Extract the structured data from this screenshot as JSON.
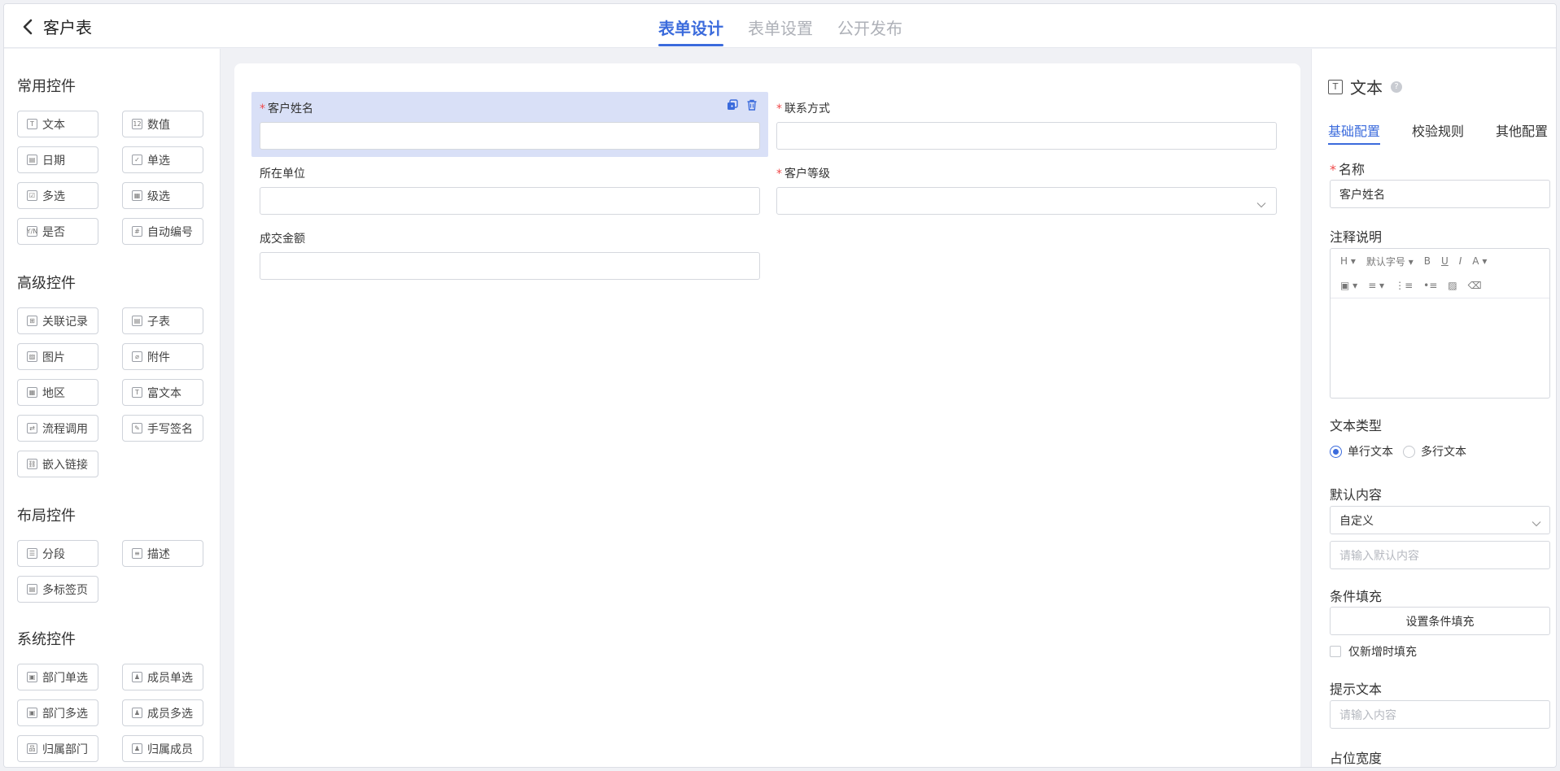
{
  "header": {
    "title": "客户表",
    "tabs": [
      {
        "label": "表单设计",
        "active": true
      },
      {
        "label": "表单设置",
        "active": false
      },
      {
        "label": "公开发布",
        "active": false
      }
    ]
  },
  "left_panel": {
    "common": {
      "title": "常用控件",
      "items": [
        "文本",
        "数值",
        "日期",
        "单选",
        "多选",
        "级选",
        "是否",
        "自动编号"
      ]
    },
    "advanced": {
      "title": "高级控件",
      "items": [
        "关联记录",
        "子表",
        "图片",
        "附件",
        "地区",
        "富文本",
        "流程调用",
        "手写签名",
        "嵌入链接"
      ]
    },
    "layout": {
      "title": "布局控件",
      "items": [
        "分段",
        "描述",
        "多标签页"
      ]
    },
    "system": {
      "title": "系统控件",
      "items": [
        "部门单选",
        "成员单选",
        "部门多选",
        "成员多选",
        "归属部门",
        "归属成员"
      ]
    }
  },
  "canvas": {
    "fields": [
      {
        "label": "客户姓名",
        "required": true,
        "selected": true
      },
      {
        "label": "联系方式",
        "required": true,
        "selected": false
      },
      {
        "label": "所在单位",
        "required": false,
        "selected": false
      },
      {
        "label": "客户等级",
        "required": true,
        "selected": false
      },
      {
        "label": "成交金额",
        "required": false,
        "selected": false
      }
    ]
  },
  "right_panel": {
    "title": "文本",
    "help_glyph": "?",
    "tabs": [
      "基础配置",
      "校验规则",
      "其他配置"
    ],
    "name_label": "名称",
    "name_value": "客户姓名",
    "note_label": "注释说明",
    "toolbar_row1": [
      "H ▾",
      "默认字号 ▾",
      "B",
      "U",
      "I",
      "A ▾"
    ],
    "toolbar_row2": [
      "▣ ▾",
      "≡ ▾",
      "⋮≡",
      "•≡",
      "▨",
      "⌫"
    ],
    "text_type_label": "文本类型",
    "text_type_options": [
      "单行文本",
      "多行文本"
    ],
    "default_label": "默认内容",
    "default_select": "自定义",
    "default_placeholder": "请输入默认内容",
    "cond_label": "条件填充",
    "cond_button": "设置条件填充",
    "cond_checkbox": "仅新增时填充",
    "hint_label": "提示文本",
    "hint_placeholder": "请输入内容",
    "width_label": "占位宽度"
  },
  "colors": {
    "accent": "#3b6bdc",
    "required": "#f04a4a",
    "selected_field_bg": "#d9e0f7",
    "page_bg": "#f0f1f5"
  }
}
